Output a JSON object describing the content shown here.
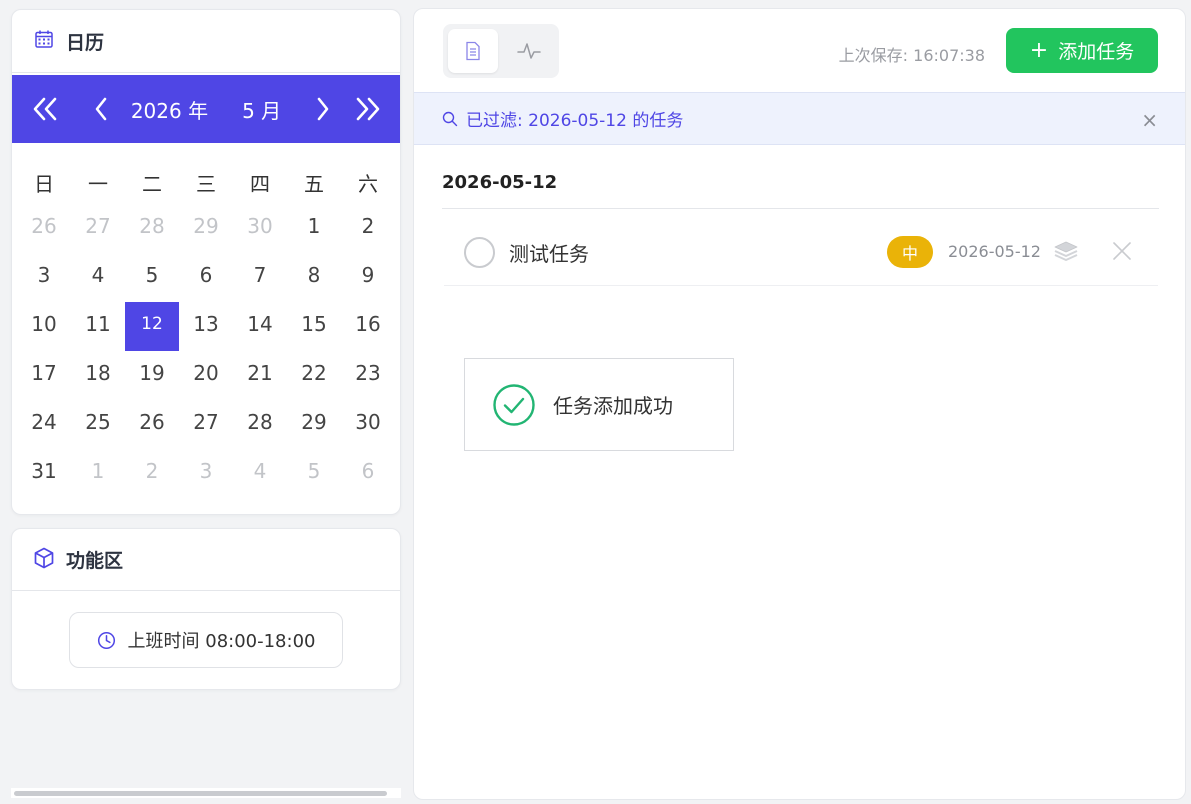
{
  "sidebar": {
    "calendar": {
      "title": "日历",
      "icon": "calendar-icon",
      "year_label": "2026 年",
      "month_label": "5 月",
      "weekdays": [
        "日",
        "一",
        "二",
        "三",
        "四",
        "五",
        "六"
      ],
      "weeks": [
        [
          {
            "d": "26",
            "m": true
          },
          {
            "d": "27",
            "m": true
          },
          {
            "d": "28",
            "m": true
          },
          {
            "d": "29",
            "m": true
          },
          {
            "d": "30",
            "m": true
          },
          {
            "d": "1"
          },
          {
            "d": "2"
          }
        ],
        [
          {
            "d": "3"
          },
          {
            "d": "4"
          },
          {
            "d": "5"
          },
          {
            "d": "6"
          },
          {
            "d": "7"
          },
          {
            "d": "8"
          },
          {
            "d": "9"
          }
        ],
        [
          {
            "d": "10"
          },
          {
            "d": "11"
          },
          {
            "d": "12",
            "sel": true
          },
          {
            "d": "13"
          },
          {
            "d": "14"
          },
          {
            "d": "15"
          },
          {
            "d": "16"
          }
        ],
        [
          {
            "d": "17"
          },
          {
            "d": "18"
          },
          {
            "d": "19"
          },
          {
            "d": "20"
          },
          {
            "d": "21"
          },
          {
            "d": "22"
          },
          {
            "d": "23"
          }
        ],
        [
          {
            "d": "24"
          },
          {
            "d": "25"
          },
          {
            "d": "26"
          },
          {
            "d": "27"
          },
          {
            "d": "28"
          },
          {
            "d": "29"
          },
          {
            "d": "30"
          }
        ],
        [
          {
            "d": "31"
          },
          {
            "d": "1",
            "m": true
          },
          {
            "d": "2",
            "m": true
          },
          {
            "d": "3",
            "m": true
          },
          {
            "d": "4",
            "m": true
          },
          {
            "d": "5",
            "m": true
          },
          {
            "d": "6",
            "m": true
          }
        ]
      ]
    },
    "functions": {
      "title": "功能区",
      "icon": "cube-icon",
      "work_time_label": "上班时间 08:00-18:00"
    }
  },
  "toolbar": {
    "last_save": "上次保存: 16:07:38",
    "add_button_label": "添加任务",
    "views": [
      "list-view-icon",
      "activity-icon"
    ]
  },
  "filter": {
    "text": "已过滤: 2026-05-12 的任务",
    "close_label": "×"
  },
  "task_group": {
    "date": "2026-05-12",
    "tasks": [
      {
        "title": "测试任务",
        "priority": "中",
        "date": "2026-05-12"
      }
    ]
  },
  "toast": {
    "message": "任务添加成功"
  },
  "colors": {
    "accent": "#4f46e5",
    "success": "#22c55e",
    "priority_medium": "#eab308"
  }
}
